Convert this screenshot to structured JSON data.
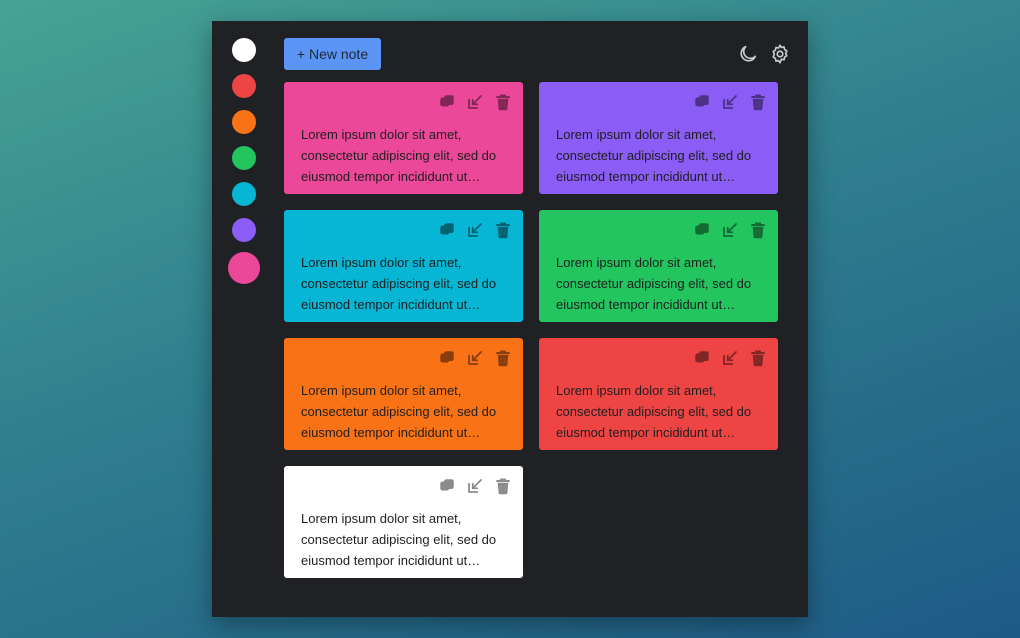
{
  "palette": [
    {
      "name": "white",
      "color": "#ffffff"
    },
    {
      "name": "red",
      "color": "#ef4444"
    },
    {
      "name": "orange",
      "color": "#f97316"
    },
    {
      "name": "green",
      "color": "#22c55e"
    },
    {
      "name": "cyan",
      "color": "#06b6d4"
    },
    {
      "name": "purple",
      "color": "#8b5cf6"
    },
    {
      "name": "pink",
      "color": "#ec4899",
      "selected": true
    }
  ],
  "toolbar": {
    "new_note_label": "+ New note",
    "icons": [
      "moon-icon",
      "gear-icon"
    ]
  },
  "notes": [
    {
      "color": "#ec4899",
      "text": "Lorem ipsum dolor sit amet, consectetur adipiscing elit, sed do eiusmod tempor incididunt ut labore et dolore magna aliqua."
    },
    {
      "color": "#8b5cf6",
      "text": "Lorem ipsum dolor sit amet, consectetur adipiscing elit, sed do eiusmod tempor incididunt ut labore et dolore magna aliqua."
    },
    {
      "color": "#06b6d4",
      "text": "Lorem ipsum dolor sit amet, consectetur adipiscing elit, sed do eiusmod tempor incididunt ut labore et dolore magna aliqua."
    },
    {
      "color": "#22c55e",
      "text": "Lorem ipsum dolor sit amet, consectetur adipiscing elit, sed do eiusmod tempor incididunt ut labore et dolore magna aliqua."
    },
    {
      "color": "#f97316",
      "text": "Lorem ipsum dolor sit amet, consectetur adipiscing elit, sed do eiusmod tempor incididunt ut labore et dolore magna aliqua."
    },
    {
      "color": "#ef4444",
      "text": "Lorem ipsum dolor sit amet, consectetur adipiscing elit, sed do eiusmod tempor incididunt ut labore et dolore magna aliqua."
    },
    {
      "color": "#ffffff",
      "text": "Lorem ipsum dolor sit amet, consectetur adipiscing elit, sed do eiusmod tempor incididunt ut labore et dolore magna aliqua."
    }
  ],
  "note_action_icons": [
    "copy-icon",
    "expand-icon",
    "trash-icon"
  ]
}
